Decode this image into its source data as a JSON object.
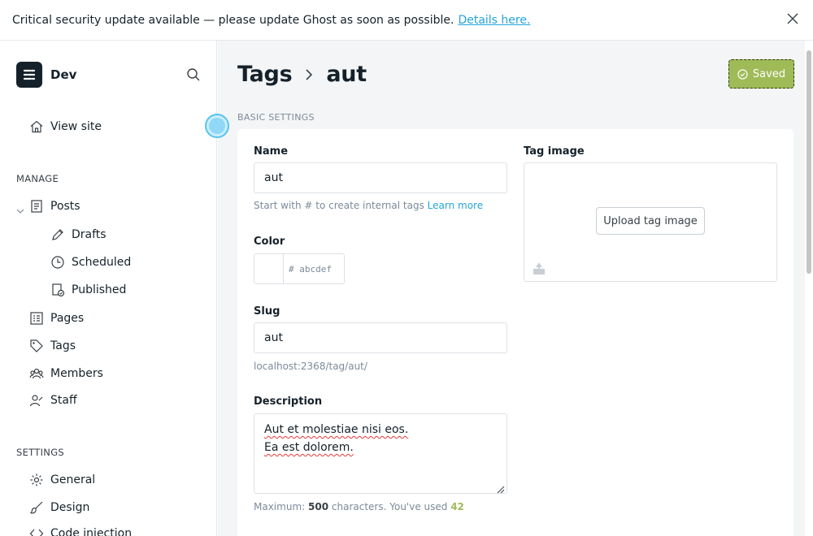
{
  "banner": {
    "message": "Critical security update available — please update Ghost as soon as possible.",
    "link": "Details here."
  },
  "sidebar": {
    "site_name": "Dev",
    "view_site": "View site",
    "manage_label": "MANAGE",
    "posts": "Posts",
    "drafts": "Drafts",
    "scheduled": "Scheduled",
    "published": "Published",
    "pages": "Pages",
    "tags": "Tags",
    "members": "Members",
    "staff": "Staff",
    "settings_label": "SETTINGS",
    "general": "General",
    "design": "Design",
    "code_injection": "Code injection"
  },
  "header": {
    "crumb_root": "Tags",
    "crumb_current": "aut",
    "save_status": "Saved"
  },
  "form": {
    "section_title": "BASIC SETTINGS",
    "name_label": "Name",
    "name_value": "aut",
    "name_hint": "Start with # to create internal tags",
    "name_hint_link": "Learn more",
    "color_label": "Color",
    "color_placeholder": "# abcdef",
    "slug_label": "Slug",
    "slug_value": "aut",
    "slug_url": "localhost:2368/tag/aut/",
    "description_label": "Description",
    "description_line1": "Aut et molestiae nisi eos.",
    "description_line2": "Ea est dolorem.",
    "desc_hint_prefix": "Maximum:",
    "desc_hint_max": "500",
    "desc_hint_mid": "characters. You've used",
    "desc_hint_used": "42",
    "image_label": "Tag image",
    "upload_label": "Upload tag image"
  },
  "colors": {
    "accent": "#9fbb58",
    "link": "#23a5d6",
    "text": "#15212a"
  }
}
